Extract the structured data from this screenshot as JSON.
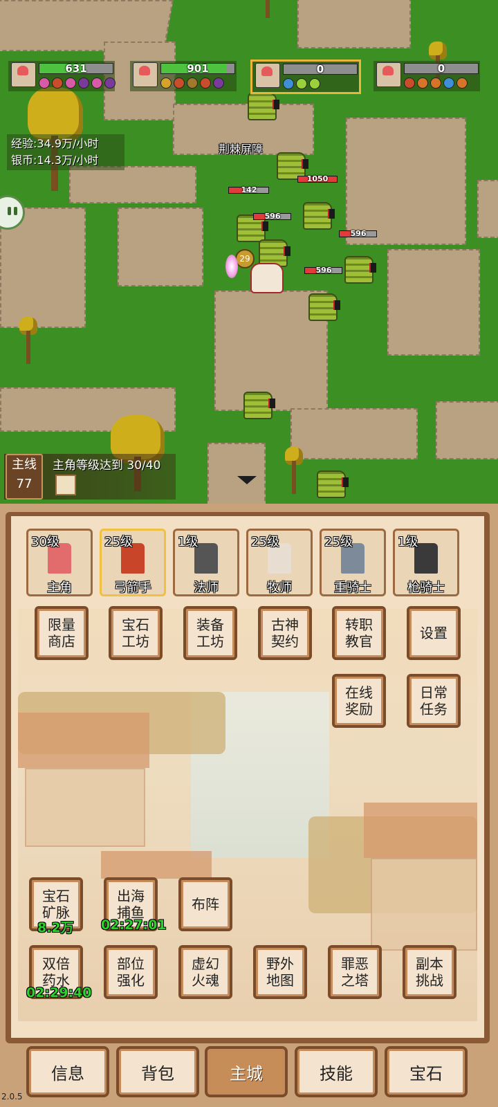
{
  "party": [
    {
      "value": "631",
      "hp_ratio": 0.62
    },
    {
      "value": "901",
      "hp_ratio": 0.9
    },
    {
      "value": "0",
      "hp_ratio": 0
    },
    {
      "value": "0",
      "hp_ratio": 0
    }
  ],
  "stats": {
    "exp": "经验:34.9万/小时",
    "silver": "银币:14.3万/小时"
  },
  "battle": {
    "skill_text": "荆棘屏障",
    "player_level": "29",
    "enemy_hp": [
      "142",
      "1050",
      "596",
      "596",
      "596"
    ]
  },
  "quest": {
    "tag": "主线",
    "number": "77",
    "text": "主角等级达到 30/40"
  },
  "heroes": [
    {
      "level": "30级",
      "name": "主角"
    },
    {
      "level": "25级",
      "name": "弓箭手"
    },
    {
      "level": "1级",
      "name": "法师"
    },
    {
      "level": "25级",
      "name": "牧师"
    },
    {
      "level": "25级",
      "name": "重骑士"
    },
    {
      "level": "1级",
      "name": "枪骑士"
    }
  ],
  "buttons": {
    "limited_shop": "限量商店",
    "gem_workshop": "宝石工坊",
    "equip_workshop": "装备工坊",
    "ancient_pact": "古神契约",
    "job_mentor": "转职教官",
    "settings": "设置",
    "online_reward": "在线奖励",
    "daily_tasks": "日常任务",
    "gem_mine": "宝石矿脉",
    "sea_fishing": "出海捕鱼",
    "formation": "布阵",
    "double_potion": "双倍药水",
    "part_enhance": "部位强化",
    "phantom_soul": "虚幻火魂",
    "field_map": "野外地图",
    "sin_tower": "罪恶之塔",
    "dungeon": "副本挑战"
  },
  "timers": {
    "gem_mine": "8.2万",
    "sea_fishing": "02:27:01",
    "double_potion": "02:29:40"
  },
  "tabs": [
    "信息",
    "背包",
    "主城",
    "技能",
    "宝石"
  ],
  "active_tab": "主城",
  "version": "2.0.5",
  "colors": {
    "hp_green": "#4cc23f",
    "enemy_hp_red": "#e23b3b",
    "timer_green": "#2dd12d",
    "panel_brown": "#7a4c2a",
    "selected_gold": "#f0c040"
  }
}
